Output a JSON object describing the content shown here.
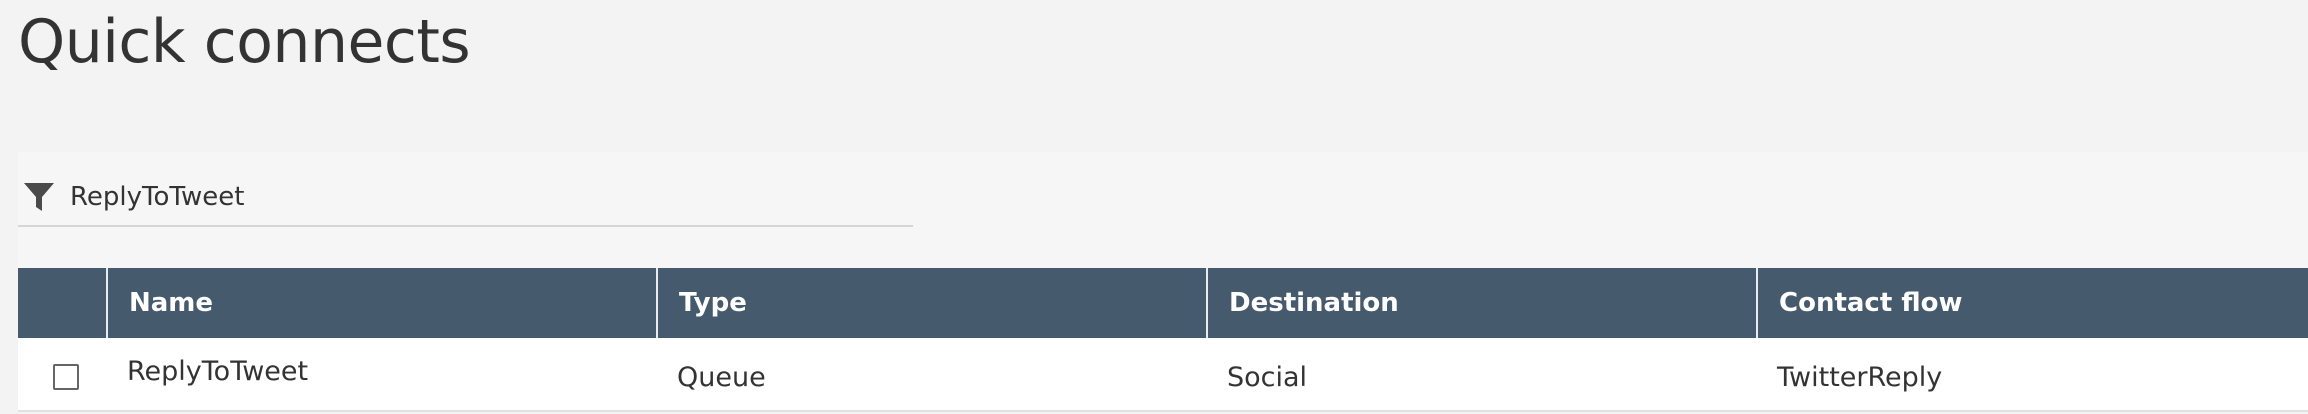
{
  "page": {
    "title": "Quick connects"
  },
  "filter": {
    "icon": "filter-icon",
    "value": "ReplyToTweet"
  },
  "table": {
    "columns": [
      "Name",
      "Type",
      "Destination",
      "Contact flow"
    ],
    "rows": [
      {
        "name": "ReplyToTweet",
        "type": "Queue",
        "destination": "Social",
        "contact_flow": "TwitterReply",
        "selected": false
      }
    ]
  },
  "colors": {
    "header_bg": "#465a6d",
    "page_bg": "#f3f3f3",
    "row_bg": "#ffffff"
  }
}
